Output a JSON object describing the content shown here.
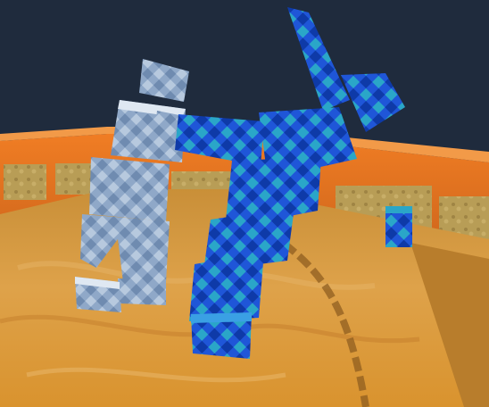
{
  "scene": {
    "type": "3d-fighting-game-scene",
    "description_visible_text": ""
  },
  "colors": {
    "sky": "#1f2b3d",
    "arena_floor": "#d79a3a",
    "arena_floor_dark": "#b97a27",
    "wall_far": "#e07a20",
    "wall_top": "#f07d24",
    "wall_panel": "#b89d56",
    "fighter_gray": "#8fa8c8",
    "fighter_gray_light": "#dfe8f2",
    "fighter_gray_dark": "#5f7aa0",
    "fighter_blue": "#1f56d8",
    "fighter_blue_dark": "#0e2f92",
    "fighter_teal": "#2aa6c8"
  },
  "icons": {
    "arena": "sumo-ring-icon",
    "fighter_left": "gray-block-fighter-icon",
    "fighter_right": "blue-block-fighter-icon",
    "small_box": "blue-crate-icon"
  }
}
